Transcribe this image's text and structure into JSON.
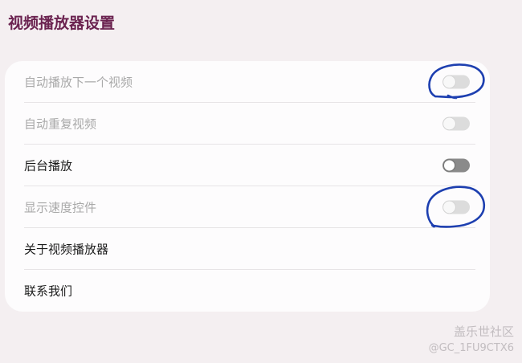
{
  "header": {
    "title": "视频播放器设置"
  },
  "settings": {
    "items": [
      {
        "label": "自动播放下一个视频",
        "has_toggle": true,
        "toggle_state": "off",
        "disabled": true
      },
      {
        "label": "自动重复视频",
        "has_toggle": true,
        "toggle_state": "off",
        "disabled": true
      },
      {
        "label": "后台播放",
        "has_toggle": true,
        "toggle_state": "off",
        "disabled": false
      },
      {
        "label": "显示速度控件",
        "has_toggle": true,
        "toggle_state": "off",
        "disabled": true
      },
      {
        "label": "关于视频播放器",
        "has_toggle": false
      },
      {
        "label": "联系我们",
        "has_toggle": false
      }
    ]
  },
  "annotations": {
    "color": "#1d3fb0",
    "circled_items": [
      "自动播放下一个视频",
      "显示速度控件"
    ]
  },
  "watermark": {
    "brand": "盖乐世社区",
    "user_id": "@GC_1FU9CTX6"
  },
  "colors": {
    "background": "#f4eff1",
    "title": "#6b2350",
    "card": "#fdfcfd",
    "disabled_text": "#a9a9a9",
    "enabled_text": "#1c1c1c"
  }
}
